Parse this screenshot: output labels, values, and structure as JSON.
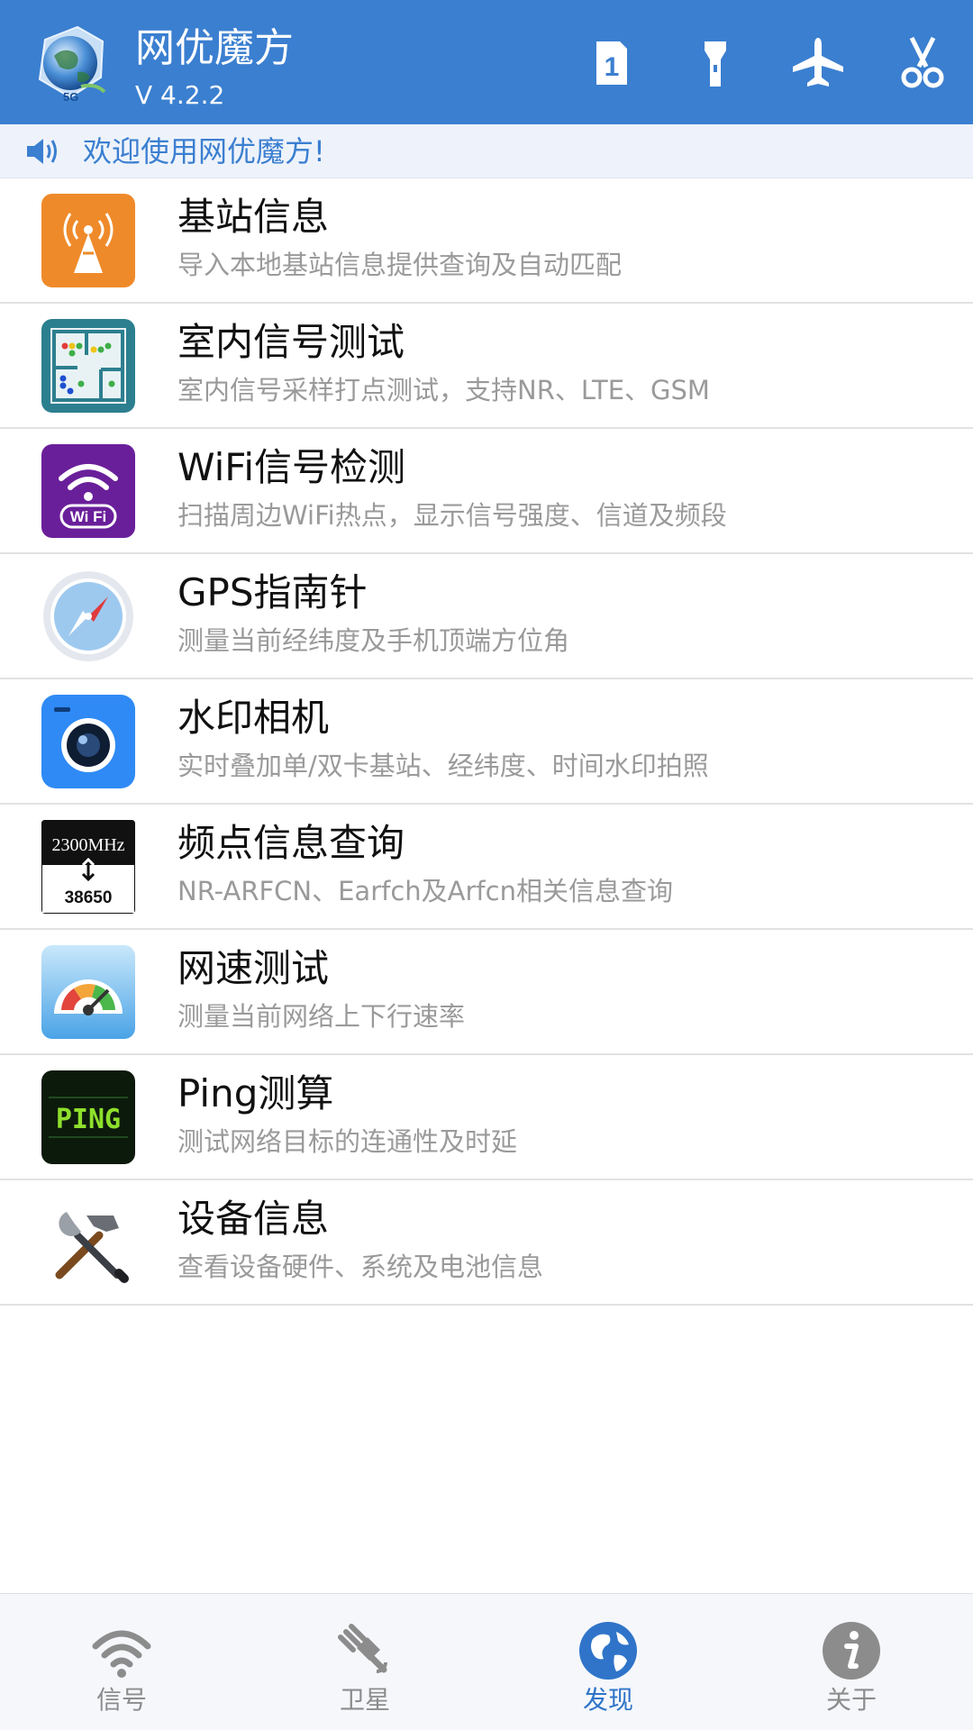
{
  "header": {
    "title": "网优魔方",
    "version": "V 4.2.2",
    "logo_badge": "5G",
    "actions": [
      {
        "name": "sim-card-icon",
        "label": "1"
      },
      {
        "name": "flashlight-icon"
      },
      {
        "name": "airplane-icon"
      },
      {
        "name": "scissors-icon"
      }
    ]
  },
  "notice": {
    "icon": "speaker-icon",
    "text": "欢迎使用网优魔方!"
  },
  "items": [
    {
      "title": "基站信息",
      "subtitle": "导入本地基站信息提供查询及自动匹配",
      "icon": "cell-tower-icon"
    },
    {
      "title": "室内信号测试",
      "subtitle": "室内信号采样打点测试，支持NR、LTE、GSM",
      "icon": "floor-plan-icon"
    },
    {
      "title": "WiFi信号检测",
      "subtitle": "扫描周边WiFi热点，显示信号强度、信道及频段",
      "icon": "wifi-icon",
      "icon_label": "Wi Fi"
    },
    {
      "title": "GPS指南针",
      "subtitle": "测量当前经纬度及手机顶端方位角",
      "icon": "compass-icon"
    },
    {
      "title": "水印相机",
      "subtitle": "实时叠加单/双卡基站、经纬度、时间水印拍照",
      "icon": "camera-icon"
    },
    {
      "title": "频点信息查询",
      "subtitle": "NR-ARFCN、Earfch及Arfcn相关信息查询",
      "icon": "frequency-icon",
      "icon_top": "2300MHz",
      "icon_bottom": "38650"
    },
    {
      "title": "网速测试",
      "subtitle": "测量当前网络上下行速率",
      "icon": "speedometer-icon"
    },
    {
      "title": "Ping测算",
      "subtitle": "测试网络目标的连通性及时延",
      "icon": "ping-icon",
      "icon_label": "PING"
    },
    {
      "title": "设备信息",
      "subtitle": "查看设备硬件、系统及电池信息",
      "icon": "tools-icon"
    }
  ],
  "bottom_nav": [
    {
      "label": "信号",
      "icon": "wifi-signal-icon",
      "active": false
    },
    {
      "label": "卫星",
      "icon": "satellite-icon",
      "active": false
    },
    {
      "label": "发现",
      "icon": "globe-icon",
      "active": true
    },
    {
      "label": "关于",
      "icon": "info-icon",
      "active": false
    }
  ],
  "colors": {
    "header_bg": "#3b7fd0",
    "accent": "#2f74c9",
    "subtitle_text": "#9a9a9a",
    "inactive_nav": "#8c8c8c"
  }
}
